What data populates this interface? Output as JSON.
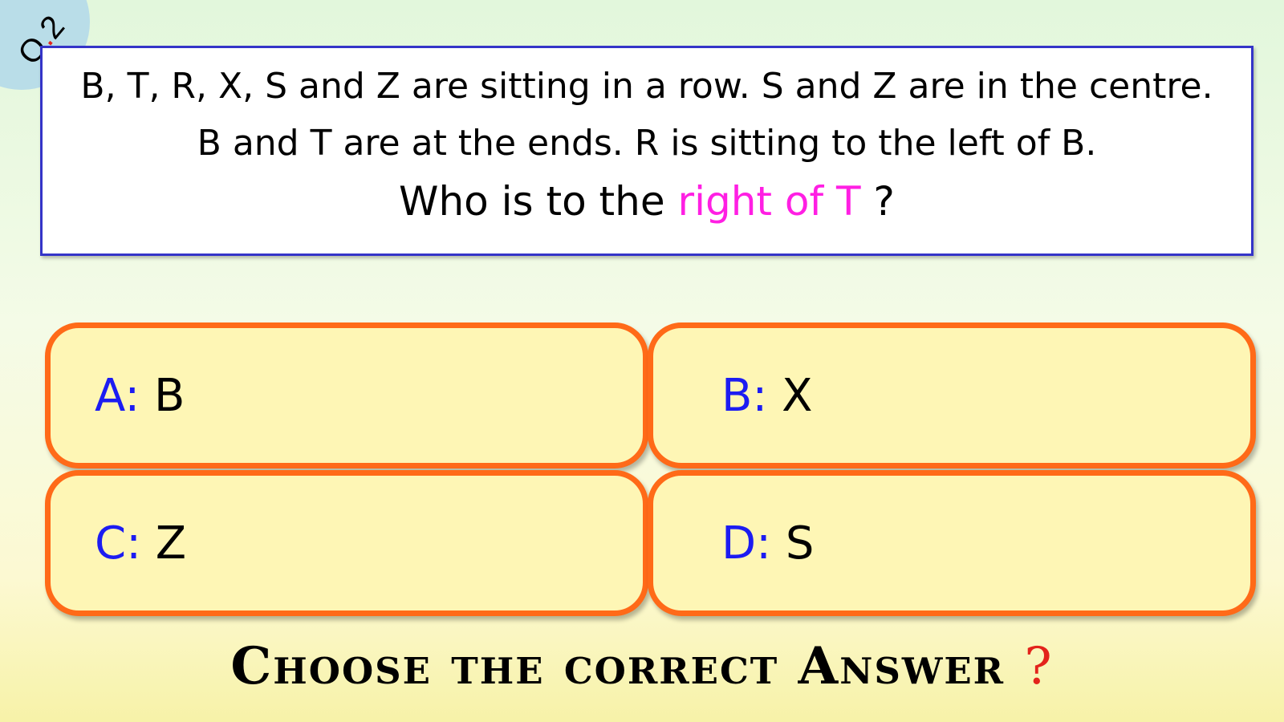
{
  "badge": {
    "prefix": "Q",
    "dot": ".",
    "number": "2"
  },
  "question": {
    "line1": "B, T, R, X, S and Z are sitting in a row. S and Z are in the centre.",
    "line2": "B and T are at the  ends. R is sitting to the left of B.",
    "line3_start": "Who is to the ",
    "line3_highlight": "right of T",
    "line3_end": " ?"
  },
  "options": [
    {
      "letter": "A:",
      "value": "B"
    },
    {
      "letter": "B:",
      "value": "X"
    },
    {
      "letter": "C:",
      "value": "Z"
    },
    {
      "letter": "D:",
      "value": "S"
    }
  ],
  "footer": {
    "text": "Choose the correct Answer",
    "mark": "?"
  },
  "colors": {
    "highlight": "#ff1fe3",
    "option_letter": "#1c1cf2",
    "option_border": "#ff6a18",
    "option_fill": "#fef6b5",
    "question_border": "#3434c8",
    "footer_mark": "#e3231b"
  }
}
